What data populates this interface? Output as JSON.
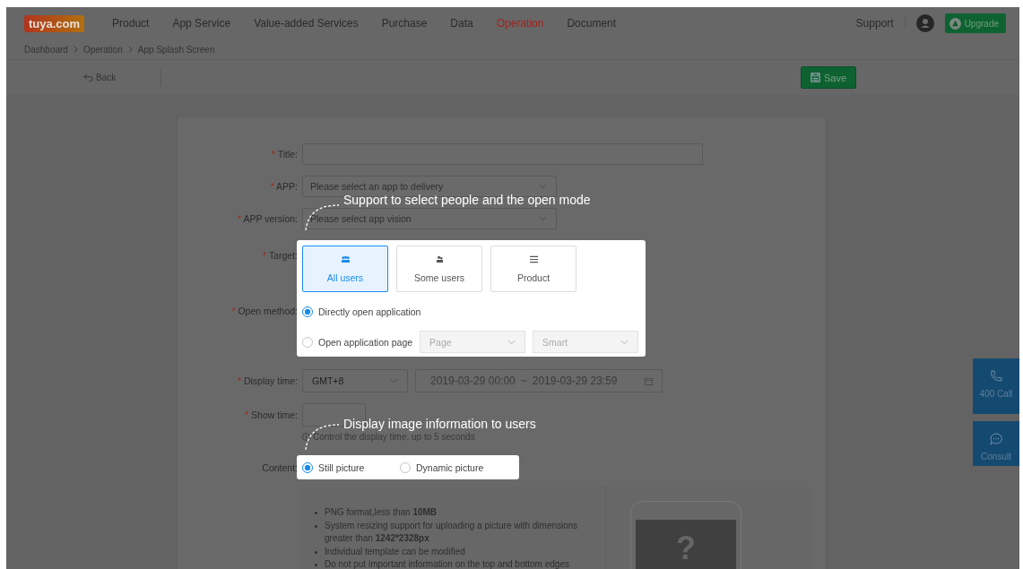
{
  "nav": {
    "logo": "tuya.com",
    "menu": [
      {
        "label": "Product",
        "selected": false
      },
      {
        "label": "App Service",
        "selected": false
      },
      {
        "label": "Value-added Services",
        "selected": false
      },
      {
        "label": "Purchase",
        "selected": false
      },
      {
        "label": "Data",
        "selected": false
      },
      {
        "label": "Operation",
        "selected": true
      },
      {
        "label": "Document",
        "selected": false
      }
    ],
    "support": "Support",
    "upgrade": "Upgrade"
  },
  "breadcrumb": [
    "Dashboard",
    "Operation",
    "App Splash Screen"
  ],
  "toolbar": {
    "back": "Back",
    "save": "Save"
  },
  "form": {
    "title": {
      "mark": "*",
      "label": "Title:"
    },
    "app": {
      "mark": "*",
      "label": "APP:",
      "placeholder": "Please select an app to delivery"
    },
    "app_version": {
      "mark": "*",
      "label": "APP version:",
      "placeholder": "Please select app vision"
    },
    "target": {
      "mark": "*",
      "label": "Target:",
      "options": [
        {
          "label": "All users",
          "kind": "all",
          "selected": true
        },
        {
          "label": "Some users",
          "kind": "some",
          "selected": false
        },
        {
          "label": "Product",
          "kind": "product",
          "selected": false
        }
      ]
    },
    "open_method": {
      "mark": "*",
      "label": "Open method:",
      "options": [
        {
          "label": "Directly open application",
          "selected": true
        },
        {
          "label": "Open application page",
          "selected": false,
          "selects": [
            "Page",
            "Smart"
          ]
        }
      ]
    },
    "display_time": {
      "mark": "*",
      "label": "Display time:",
      "timezone": "GMT+8",
      "start": "2019-03-29 00:00",
      "separator": "~",
      "end": "2019-03-29 23:59"
    },
    "show_time": {
      "mark": "*",
      "label": "Show time:",
      "hint": "Control the display time, up to 5 seconds"
    },
    "content": {
      "label": "Content:",
      "options": [
        {
          "label": "Still picture",
          "selected": true
        },
        {
          "label": "Dynamic picture",
          "selected": false
        }
      ]
    },
    "upload": {
      "rules": [
        "PNG format,less than **10MB**",
        "System resizing support for uploading a picture with dimensions greater than **1242*2328px**",
        "Individual template can be modified",
        "Do not put important information on the top and bottom edges"
      ],
      "preview_mark": "?"
    }
  },
  "callouts": [
    "Support to select  people and the open mode",
    "Display image information to users"
  ],
  "side_buttons": [
    {
      "label": "400 Call",
      "kind": "call"
    },
    {
      "label": "Consult",
      "kind": "chat"
    }
  ]
}
